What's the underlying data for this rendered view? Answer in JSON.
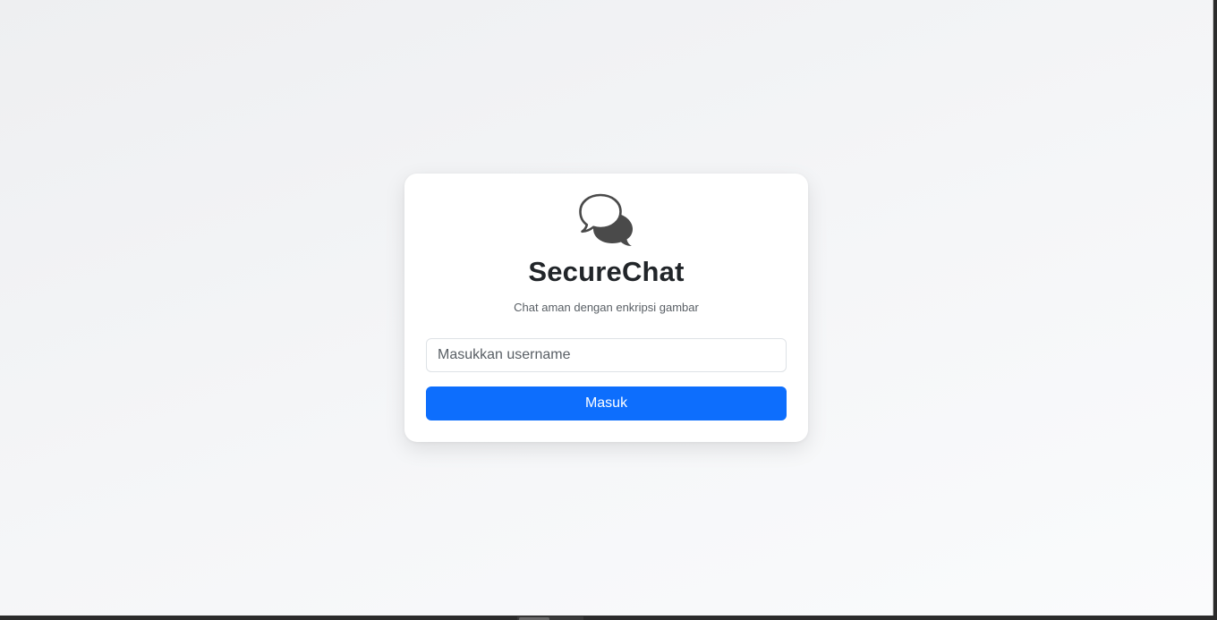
{
  "app": {
    "title": "SecureChat",
    "subtitle": "Chat aman dengan enkripsi gambar",
    "logo_icon": "chat-bubbles-icon"
  },
  "login": {
    "username_placeholder": "Masukkan username",
    "username_value": "",
    "submit_label": "Masuk"
  },
  "colors": {
    "primary": "#0d6efd",
    "title_text": "#212529",
    "muted_text": "#595f65",
    "icon": "#4a4a4a",
    "card_background": "#ffffff"
  }
}
